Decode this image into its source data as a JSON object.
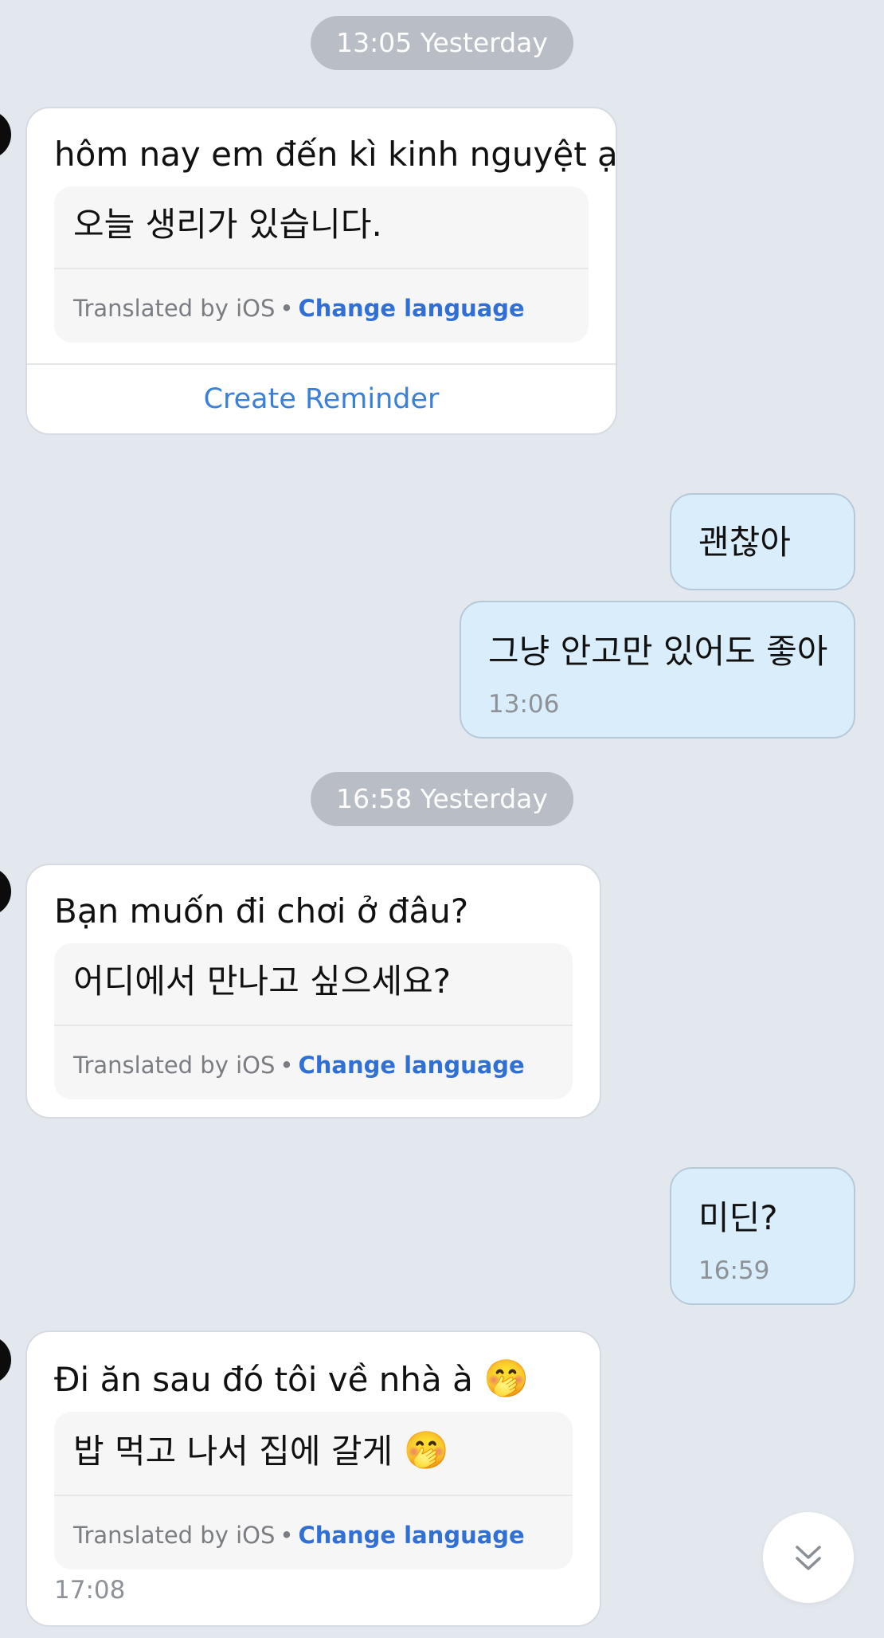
{
  "chat": {
    "separators": [
      "13:05 Yesterday",
      "16:58 Yesterday"
    ],
    "incoming": [
      {
        "text": "hôm nay em đến kì kinh nguyệt ạ",
        "translation": "오늘 생리가 있습니다.",
        "translated_by": "Translated by iOS",
        "change_language": "Change language",
        "action": "Create Reminder"
      },
      {
        "text": "Bạn muốn đi chơi ở đâu?",
        "translation": "어디에서 만나고 싶으세요?",
        "translated_by": "Translated by iOS",
        "change_language": "Change language"
      },
      {
        "text": "Đi ăn sau đó tôi về nhà à",
        "text_emoji": "🤭",
        "translation": "밥 먹고 나서 집에 갈게",
        "translation_emoji": "🤭",
        "translated_by": "Translated by iOS",
        "change_language": "Change language",
        "time": "17:08"
      }
    ],
    "outgoing": [
      {
        "text": "괜찮아"
      },
      {
        "text": "그냥 안고만 있어도 좋아",
        "time": "13:06"
      },
      {
        "text": "미딘?",
        "time": "16:59"
      }
    ],
    "dot_separator": "•"
  },
  "icons": {
    "scroll_down": "chevrons-down-icon",
    "avatar": "avatar"
  },
  "colors": {
    "background": "#e3e8ef",
    "outgoing_bubble": "#d9edfb",
    "link": "#2f6fd6",
    "date_pill": "#b9bec6"
  }
}
